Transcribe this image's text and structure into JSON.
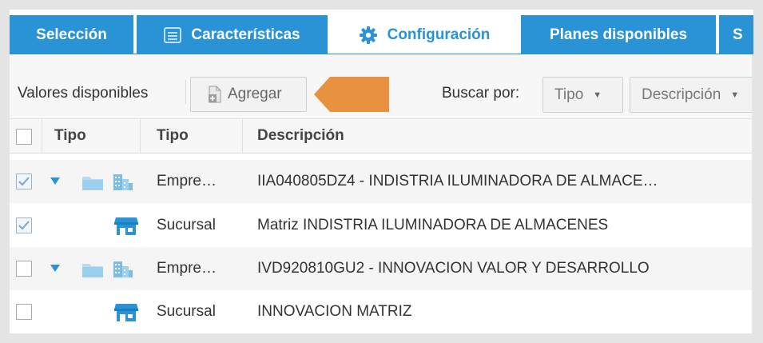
{
  "tabs": [
    {
      "label": "Selección",
      "icon": null,
      "active": false
    },
    {
      "label": "Características",
      "icon": "list-icon",
      "active": false
    },
    {
      "label": "Configuración",
      "icon": "gear-icon",
      "active": true
    },
    {
      "label": "Planes disponibles",
      "icon": null,
      "active": false
    },
    {
      "label": "S",
      "icon": null,
      "active": false
    }
  ],
  "toolbar": {
    "label": "Valores disponibles",
    "add_label": "Agregar",
    "search_label": "Buscar por:",
    "filter_tipo": "Tipo",
    "filter_descripcion": "Descripción"
  },
  "table": {
    "columns": [
      "Tipo",
      "Tipo",
      "Descripción"
    ],
    "rows": [
      {
        "checked": true,
        "expandable": true,
        "kind": "empresa",
        "tipo": "Empre…",
        "descripcion": "IIA040805DZ4 - INDISTRIA ILUMINADORA DE ALMACE…"
      },
      {
        "checked": true,
        "expandable": false,
        "kind": "sucursal",
        "tipo": "Sucursal",
        "descripcion": "Matriz INDISTRIA ILUMINADORA DE ALMACENES"
      },
      {
        "checked": false,
        "expandable": true,
        "kind": "empresa",
        "tipo": "Empre…",
        "descripcion": "IVD920810GU2 - INNOVACION VALOR Y DESARROLLO"
      },
      {
        "checked": false,
        "expandable": false,
        "kind": "sucursal",
        "tipo": "Sucursal",
        "descripcion": "INNOVACION MATRIZ"
      }
    ]
  },
  "colors": {
    "accent": "#2a93d5",
    "pointer_arrow": "#e8913f"
  }
}
